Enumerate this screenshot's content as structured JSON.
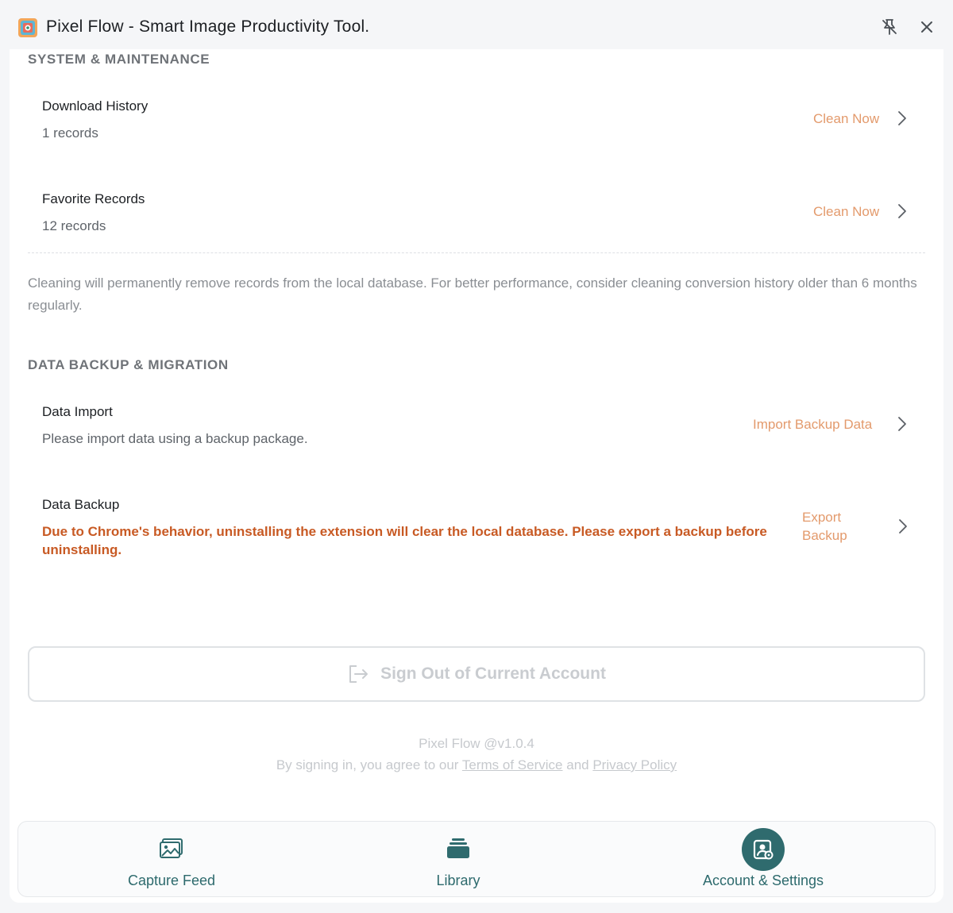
{
  "app": {
    "title": "Pixel Flow - Smart Image Productivity Tool."
  },
  "system": {
    "section_title": "SYSTEM & MAINTENANCE",
    "rows": [
      {
        "title": "Download History",
        "sub": "1 records",
        "action": "Clean Now"
      },
      {
        "title": "Favorite Records",
        "sub": "12 records",
        "action": "Clean Now"
      }
    ],
    "note": "Cleaning will permanently remove records from the local database. For better performance, consider cleaning conversion history older than 6 months regularly."
  },
  "backup": {
    "section_title": "DATA BACKUP & MIGRATION",
    "import": {
      "title": "Data Import",
      "sub": "Please import data using a backup package.",
      "action": "Import Backup Data"
    },
    "export": {
      "title": "Data Backup",
      "warning": "Due to Chrome's behavior, uninstalling the extension will clear the local database. Please export a backup before uninstalling.",
      "action_line1": "Export",
      "action_line2": "Backup"
    }
  },
  "account": {
    "signout_label": "Sign Out of Current Account",
    "version": "Pixel Flow @v1.0.4",
    "terms_prefix": "By signing in, you agree to our",
    "terms_link": "Terms of Service",
    "terms_and": "and",
    "privacy_link": "Privacy Policy"
  },
  "nav": {
    "items": [
      {
        "label": "Capture Feed",
        "icon": "image-gallery-icon"
      },
      {
        "label": "Library",
        "icon": "stack-icon"
      },
      {
        "label": "Account & Settings",
        "icon": "account-settings-icon",
        "active": true
      }
    ]
  },
  "colors": {
    "accent": "#2f6b6e",
    "action": "#e39a6c",
    "warning": "#c85a24"
  }
}
